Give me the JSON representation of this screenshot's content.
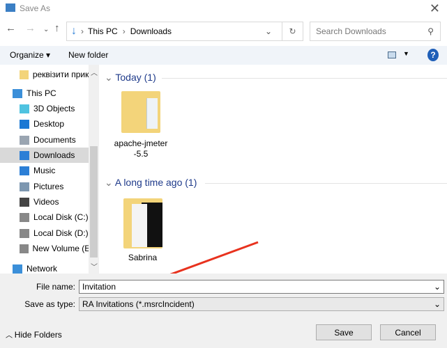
{
  "window": {
    "title": "Save As"
  },
  "address": {
    "crumbs": [
      "This PC",
      "Downloads"
    ],
    "sep": "›"
  },
  "search": {
    "placeholder": "Search Downloads"
  },
  "toolbar": {
    "organize": "Organize ▾",
    "new_folder": "New folder",
    "help": "?"
  },
  "sidebar": {
    "items": [
      {
        "label": "реквізити прикл",
        "icon": "folder-icon",
        "color": "#f3d47a"
      },
      {
        "label": "This PC",
        "icon": "computer-icon",
        "color": "#3b8fd9"
      },
      {
        "label": "3D Objects",
        "icon": "cube-icon",
        "color": "#4fc3e0"
      },
      {
        "label": "Desktop",
        "icon": "desktop-icon",
        "color": "#1a78d4"
      },
      {
        "label": "Documents",
        "icon": "document-icon",
        "color": "#9aa5b1"
      },
      {
        "label": "Downloads",
        "icon": "download-icon",
        "color": "#2c7fd6",
        "selected": true
      },
      {
        "label": "Music",
        "icon": "music-icon",
        "color": "#2c7fd6"
      },
      {
        "label": "Pictures",
        "icon": "pictures-icon",
        "color": "#7d97b0"
      },
      {
        "label": "Videos",
        "icon": "videos-icon",
        "color": "#444"
      },
      {
        "label": "Local Disk (C:)",
        "icon": "drive-icon",
        "color": "#888"
      },
      {
        "label": "Local Disk (D:)",
        "icon": "drive-icon",
        "color": "#888"
      },
      {
        "label": "New Volume (E:)",
        "icon": "drive-icon",
        "color": "#888"
      },
      {
        "label": "Network",
        "icon": "network-icon",
        "color": "#3b8fd9"
      }
    ]
  },
  "groups": [
    {
      "label": "Today (1)",
      "items": [
        "apache-jmeter-5.5"
      ]
    },
    {
      "label": "A long time ago (1)",
      "items": [
        "Sabrina"
      ]
    }
  ],
  "form": {
    "file_name_label": "File name:",
    "file_name": "Invitation",
    "type_label": "Save as type:",
    "type": "RA Invitations (*.msrcIncident)"
  },
  "footer": {
    "hide_folders": "Hide Folders",
    "save": "Save",
    "cancel": "Cancel"
  },
  "annotation": {
    "arrow_color": "#e8321e"
  }
}
